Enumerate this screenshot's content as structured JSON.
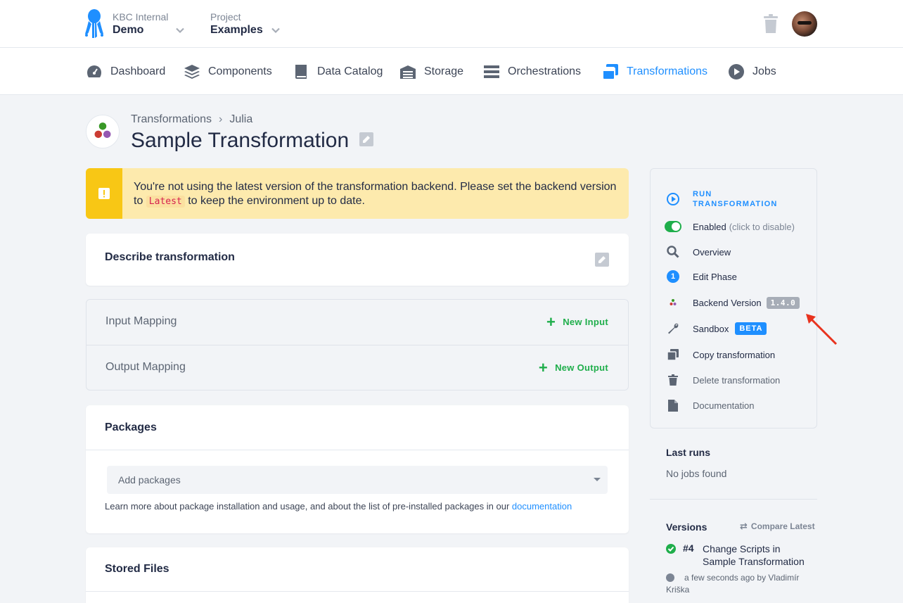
{
  "header": {
    "org_label": "KBC Internal",
    "org_name": "Demo",
    "project_label": "Project",
    "project_name": "Examples"
  },
  "nav": [
    {
      "label": "Dashboard",
      "icon": "dashboard-icon"
    },
    {
      "label": "Components",
      "icon": "layers-icon"
    },
    {
      "label": "Data Catalog",
      "icon": "book-icon"
    },
    {
      "label": "Storage",
      "icon": "warehouse-icon"
    },
    {
      "label": "Orchestrations",
      "icon": "bars-icon"
    },
    {
      "label": "Transformations",
      "icon": "window-restore-icon",
      "active": true
    },
    {
      "label": "Jobs",
      "icon": "play-circle-icon"
    }
  ],
  "page": {
    "breadcrumb_parent": "Transformations",
    "breadcrumb_current": "Julia",
    "title": "Sample Transformation"
  },
  "alert": {
    "text_before": "You're not using the latest version of the transformation backend. Please set the backend version to",
    "code": "Latest",
    "text_after": "to keep the environment up to date."
  },
  "describe": {
    "title": "Describe transformation"
  },
  "mapping": {
    "input_label": "Input Mapping",
    "input_button": "New Input",
    "output_label": "Output Mapping",
    "output_button": "New Output"
  },
  "packages": {
    "title": "Packages",
    "placeholder": "Add packages",
    "help_text": "Learn more about package installation and usage, and about the list of pre-installed packages in our",
    "help_link": "documentation"
  },
  "stored_files": {
    "title": "Stored Files"
  },
  "sidebar": {
    "run_line1": "RUN",
    "run_line2": "TRANSFORMATION",
    "enabled": "Enabled",
    "enabled_hint": "(click to disable)",
    "overview": "Overview",
    "edit_phase": "Edit Phase",
    "phase_number": "1",
    "backend_version": "Backend Version",
    "backend_version_value": "1.4.0",
    "sandbox": "Sandbox",
    "sandbox_badge": "BETA",
    "copy": "Copy transformation",
    "delete": "Delete transformation",
    "documentation": "Documentation"
  },
  "last_runs": {
    "title": "Last runs",
    "empty": "No jobs found"
  },
  "versions": {
    "title": "Versions",
    "compare": "Compare Latest",
    "items": [
      {
        "number": "#4",
        "description": "Change Scripts in Sample Transformation",
        "meta": "a few seconds ago by Vladimír Kriška"
      }
    ]
  },
  "colors": {
    "accent": "#1f8fff",
    "success": "#1fae4b",
    "warning": "#f8c715",
    "warning_bg": "#fdeaad",
    "annotation_arrow": "#e8321e"
  }
}
